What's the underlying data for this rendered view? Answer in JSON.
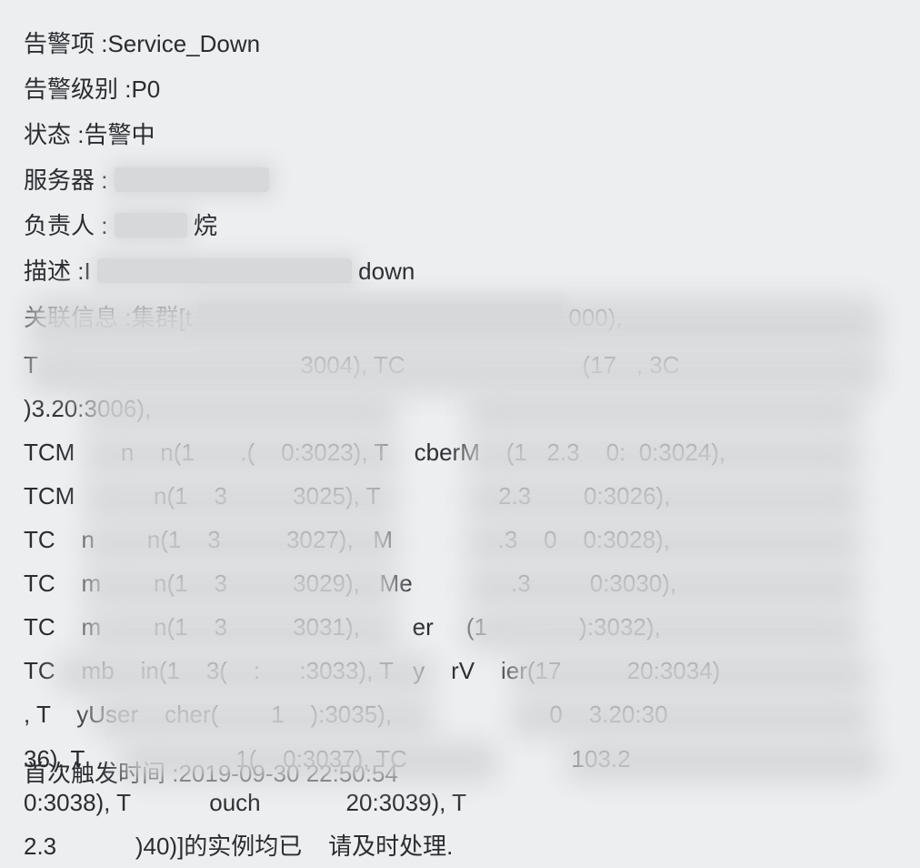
{
  "fields": {
    "alert_item": {
      "label": "告警项",
      "value": "Service_Down"
    },
    "alert_level": {
      "label": "告警级别",
      "value": "P0"
    },
    "status": {
      "label": "状态",
      "value": "告警中"
    },
    "server": {
      "label": "服务器",
      "value": "",
      "redacted": true
    },
    "owner": {
      "label": "负责人",
      "value": "",
      "redacted": true,
      "suffix": "烷"
    },
    "description": {
      "label": "描述",
      "prefix": "I",
      "redacted": true,
      "suffix": "down"
    },
    "related": {
      "label": "关联信息",
      "prefix": "集群[t",
      "redacted": true,
      "suffix": "000),"
    }
  },
  "related_body": "T                                        3004), TC                           (17   , 3C                                           )3.20:3006),\nTCM       n    n(1       .(    0:3023), T    cberM    (1   2.3    0:  0:3024),\nTCM            n(1    3          3025), T                  2.3        0:3026),\nTC    n        n(1    3          3027),   M                .3    0    0:3028),\nTC    m        n(1    3          3029),   Me               .3         0:3030),\nTC    m        n(1    3          3031),        er     (1              ):3032),\nTC    mb    in(1    3(    :      :3033), T   y    rV    ier(17          20:3034)\n, T    yUser    cher(        1    ):3035),                        0    3.20:30\n36), T                       1(    0:3037), TC                         103.2\n0:3038), T            ouch             20:3039), T\n2.3            )40)]的实例均已    请及时处理.",
  "first_trigger": {
    "label": "首次触发时间",
    "value": "2019-09-30 22:50:54"
  },
  "colon": " :"
}
